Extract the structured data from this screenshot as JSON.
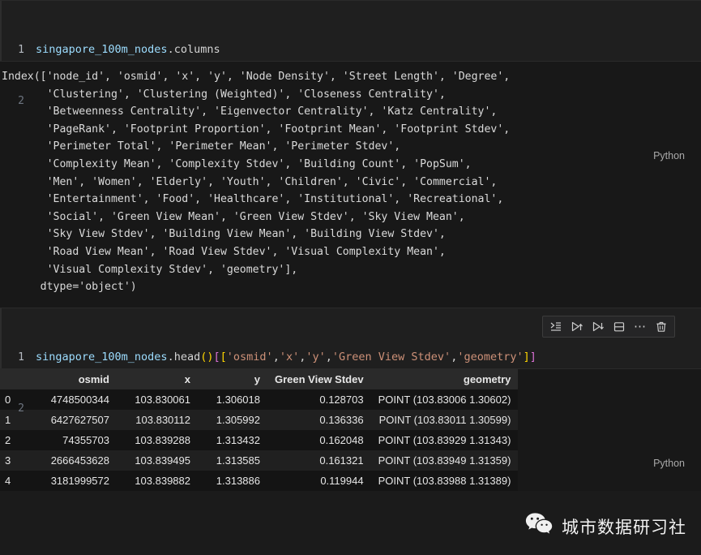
{
  "cells": [
    {
      "language_label": "Python",
      "line_numbers": [
        "1",
        "2"
      ],
      "source": "singapore_100m_nodes.columns",
      "tokens": [
        {
          "t": "singapore_100m_nodes",
          "c": "tok-var"
        },
        {
          "t": ".columns",
          "c": "tok-plain"
        }
      ],
      "output_text": "Index(['node_id', 'osmid', 'x', 'y', 'Node Density', 'Street Length', 'Degree',\n       'Clustering', 'Clustering (Weighted)', 'Closeness Centrality',\n       'Betweenness Centrality', 'Eigenvector Centrality', 'Katz Centrality',\n       'PageRank', 'Footprint Proportion', 'Footprint Mean', 'Footprint Stdev',\n       'Perimeter Total', 'Perimeter Mean', 'Perimeter Stdev',\n       'Complexity Mean', 'Complexity Stdev', 'Building Count', 'PopSum',\n       'Men', 'Women', 'Elderly', 'Youth', 'Children', 'Civic', 'Commercial',\n       'Entertainment', 'Food', 'Healthcare', 'Institutional', 'Recreational',\n       'Social', 'Green View Mean', 'Green View Stdev', 'Sky View Mean',\n       'Sky View Stdev', 'Building View Mean', 'Building View Stdev',\n       'Road View Mean', 'Road View Stdev', 'Visual Complexity Mean',\n       'Visual Complexity Stdev', 'geometry'],\n      dtype='object')"
    },
    {
      "language_label": "Python",
      "line_numbers": [
        "1",
        "2"
      ],
      "source": "singapore_100m_nodes.head()[['osmid','x','y','Green View Stdev','geometry']]",
      "tokens": [
        {
          "t": "singapore_100m_nodes",
          "c": "tok-var"
        },
        {
          "t": ".",
          "c": "tok-plain"
        },
        {
          "t": "head",
          "c": "tok-plain"
        },
        {
          "t": "(",
          "c": "tok-paren"
        },
        {
          "t": ")",
          "c": "tok-paren"
        },
        {
          "t": "[",
          "c": "tok-br1"
        },
        {
          "t": "[",
          "c": "tok-br2"
        },
        {
          "t": "'osmid'",
          "c": "tok-str"
        },
        {
          "t": ",",
          "c": "tok-punc"
        },
        {
          "t": "'x'",
          "c": "tok-str"
        },
        {
          "t": ",",
          "c": "tok-punc"
        },
        {
          "t": "'y'",
          "c": "tok-str"
        },
        {
          "t": ",",
          "c": "tok-punc"
        },
        {
          "t": "'Green View Stdev'",
          "c": "tok-str"
        },
        {
          "t": ",",
          "c": "tok-punc"
        },
        {
          "t": "'geometry'",
          "c": "tok-str"
        },
        {
          "t": "]",
          "c": "tok-br2"
        },
        {
          "t": "]",
          "c": "tok-br1"
        }
      ]
    }
  ],
  "cell_toolbar": {
    "buttons": [
      {
        "name": "execute-cell-icon",
        "title": "Execute Cell"
      },
      {
        "name": "execute-above-cells-icon",
        "title": "Execute Above Cells"
      },
      {
        "name": "execute-cell-and-below-icon",
        "title": "Execute Cell and Below"
      },
      {
        "name": "split-cell-icon",
        "title": "Split Cell"
      },
      {
        "name": "more-actions-icon",
        "title": "More Actions...",
        "glyph": "⋯"
      },
      {
        "name": "delete-cell-icon",
        "title": "Delete Cell"
      }
    ]
  },
  "dataframe": {
    "index_header": "",
    "columns": [
      "osmid",
      "x",
      "y",
      "Green View Stdev",
      "geometry"
    ],
    "rows": [
      {
        "index": "0",
        "values": [
          "4748500344",
          "103.830061",
          "1.306018",
          "0.128703",
          "POINT (103.83006 1.30602)"
        ]
      },
      {
        "index": "1",
        "values": [
          "6427627507",
          "103.830112",
          "1.305992",
          "0.136336",
          "POINT (103.83011 1.30599)"
        ]
      },
      {
        "index": "2",
        "values": [
          "74355703",
          "103.839288",
          "1.313432",
          "0.162048",
          "POINT (103.83929 1.31343)"
        ]
      },
      {
        "index": "3",
        "values": [
          "2666453628",
          "103.839495",
          "1.313585",
          "0.161321",
          "POINT (103.83949 1.31359)"
        ]
      },
      {
        "index": "4",
        "values": [
          "3181999572",
          "103.839882",
          "1.313886",
          "0.119944",
          "POINT (103.83988 1.31389)"
        ]
      }
    ]
  },
  "watermark": {
    "icon": "wechat-icon",
    "text": "城市数据研习社"
  },
  "colors": {
    "background": "#1b1b1b",
    "cell_background": "#1f1f1f",
    "output_background": "#181818",
    "variable": "#9cdcfe",
    "string": "#ce9178",
    "bracket_purple": "#da70d6",
    "bracket_yellow": "#ffd700",
    "text": "#d4d4d4",
    "line_number": "#6e7681",
    "table_header_bg": "#2a2a2a"
  }
}
